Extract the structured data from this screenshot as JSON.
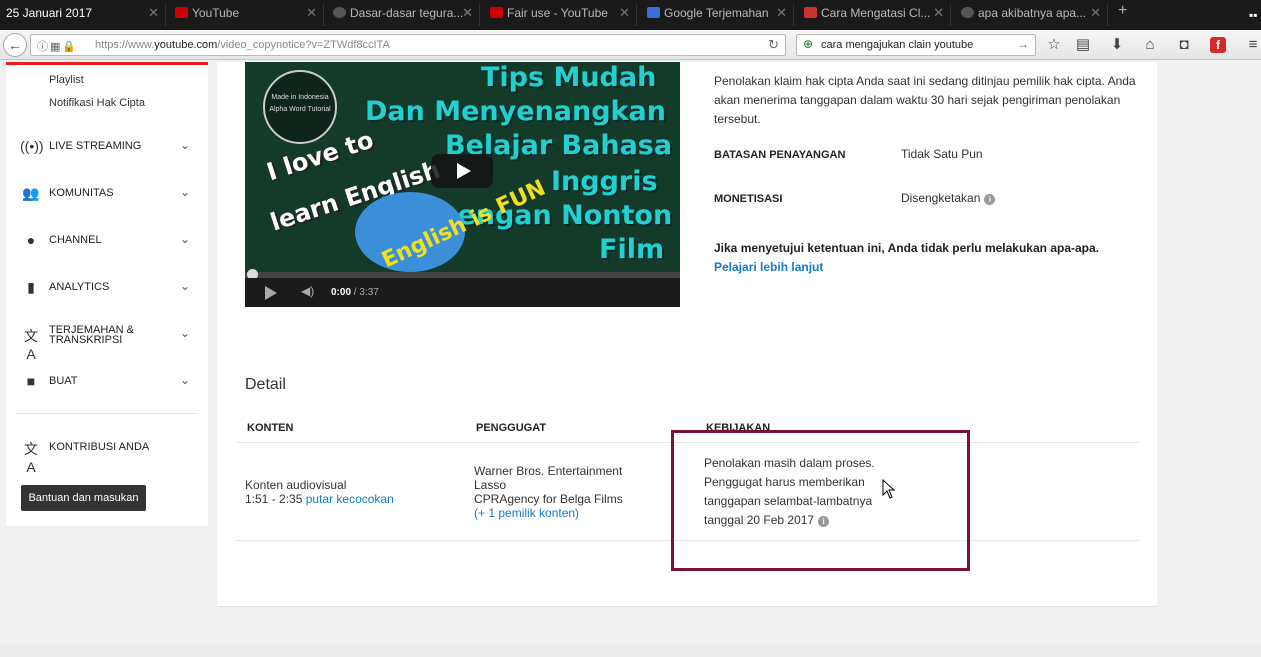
{
  "taskbar": {
    "date": "25 Januari 2017"
  },
  "tabs": [
    {
      "label": "",
      "color": "#cc0000"
    },
    {
      "label": "YouTube",
      "color": "#cc0000"
    },
    {
      "label": "Dasar-dasar tegura...",
      "color": "#4a4a4a"
    },
    {
      "label": "Fair use - YouTube",
      "color": "#cc0000"
    },
    {
      "label": "Google Terjemahan",
      "color": "#3a6fd8"
    },
    {
      "label": "Cara Mengatasi Cl...",
      "color": "#cc3333"
    },
    {
      "label": "apa akibatnya apa...",
      "color": "#4a4a4a"
    }
  ],
  "browser": {
    "url_prefix": "https://www.",
    "url_host": "youtube.com",
    "url_path": "/video_copynotice?v=ZTWdf8ccITA",
    "search_query": "cara mengajukan clain youtube",
    "flash_icon": "f"
  },
  "sidebar": {
    "sub_items": [
      "Playlist",
      "Notifikasi Hak Cipta"
    ],
    "sections": [
      {
        "label": "LIVE STREAMING",
        "icon": "((•))",
        "icon_name": "live-icon"
      },
      {
        "label": "KOMUNITAS",
        "icon": "👥",
        "icon_name": "community-icon"
      },
      {
        "label": "CHANNEL",
        "icon": "●",
        "icon_name": "channel-icon"
      },
      {
        "label": "ANALYTICS",
        "icon": "▮",
        "icon_name": "analytics-icon"
      },
      {
        "label": "TERJEMAHAN & TRANSKRIPSI",
        "icon": "文A",
        "icon_name": "translate-icon"
      },
      {
        "label": "BUAT",
        "icon": "■",
        "icon_name": "create-icon"
      }
    ],
    "contribution": {
      "label": "KONTRIBUSI ANDA",
      "icon": "文A"
    },
    "help_button": "Bantuan dan masukan"
  },
  "video": {
    "title_lines": [
      "Tips Mudah",
      "Dan Menyenangkan",
      "Belajar Bahasa",
      "Inggris",
      "Dengan Nonton",
      "Film"
    ],
    "left_lines": [
      "I love to",
      "learn English"
    ],
    "badge_text": "Made in Indonesia Alpha Word Tutorial",
    "fun_text": "English is FUN",
    "time_current": "0:00",
    "time_separator": " / ",
    "time_total": "3:37"
  },
  "notice": {
    "text": "Penolakan klaim hak cipta Anda saat ini sedang ditinjau pemilik hak cipta. Anda akan menerima tanggapan dalam waktu 30 hari sejak pengiriman penolakan tersebut.",
    "rows": [
      {
        "label": "BATASAN PENAYANGAN",
        "value": "Tidak Satu Pun"
      },
      {
        "label": "MONETISASI",
        "value": "Disengketakan"
      }
    ],
    "agree_text": "Jika menyetujui ketentuan ini, Anda tidak perlu melakukan apa-apa.",
    "learn_more": "Pelajari lebih lanjut"
  },
  "detail": {
    "title": "Detail",
    "headers": {
      "content": "KONTEN",
      "claimant": "PENGGUGAT",
      "action": "KEBIJAKAN"
    },
    "row": {
      "content_type": "Konten audiovisual",
      "range": "1:51 - 2:35",
      "range_link": "putar kecocokan",
      "claimants": [
        "Warner Bros. Entertainment",
        "Lasso",
        "CPRAgency for Belga Films"
      ],
      "more_owners": "(+ 1 pemilik konten)",
      "objection_text": "Penolakan masih dalam proses. Penggugat harus memberikan tanggapan selambat-lambatnya tanggal 20 Feb 2017"
    }
  },
  "colors": {
    "accent_red": "#e62117",
    "link_blue": "#167ac6",
    "highlight_box": "#7a1230"
  }
}
